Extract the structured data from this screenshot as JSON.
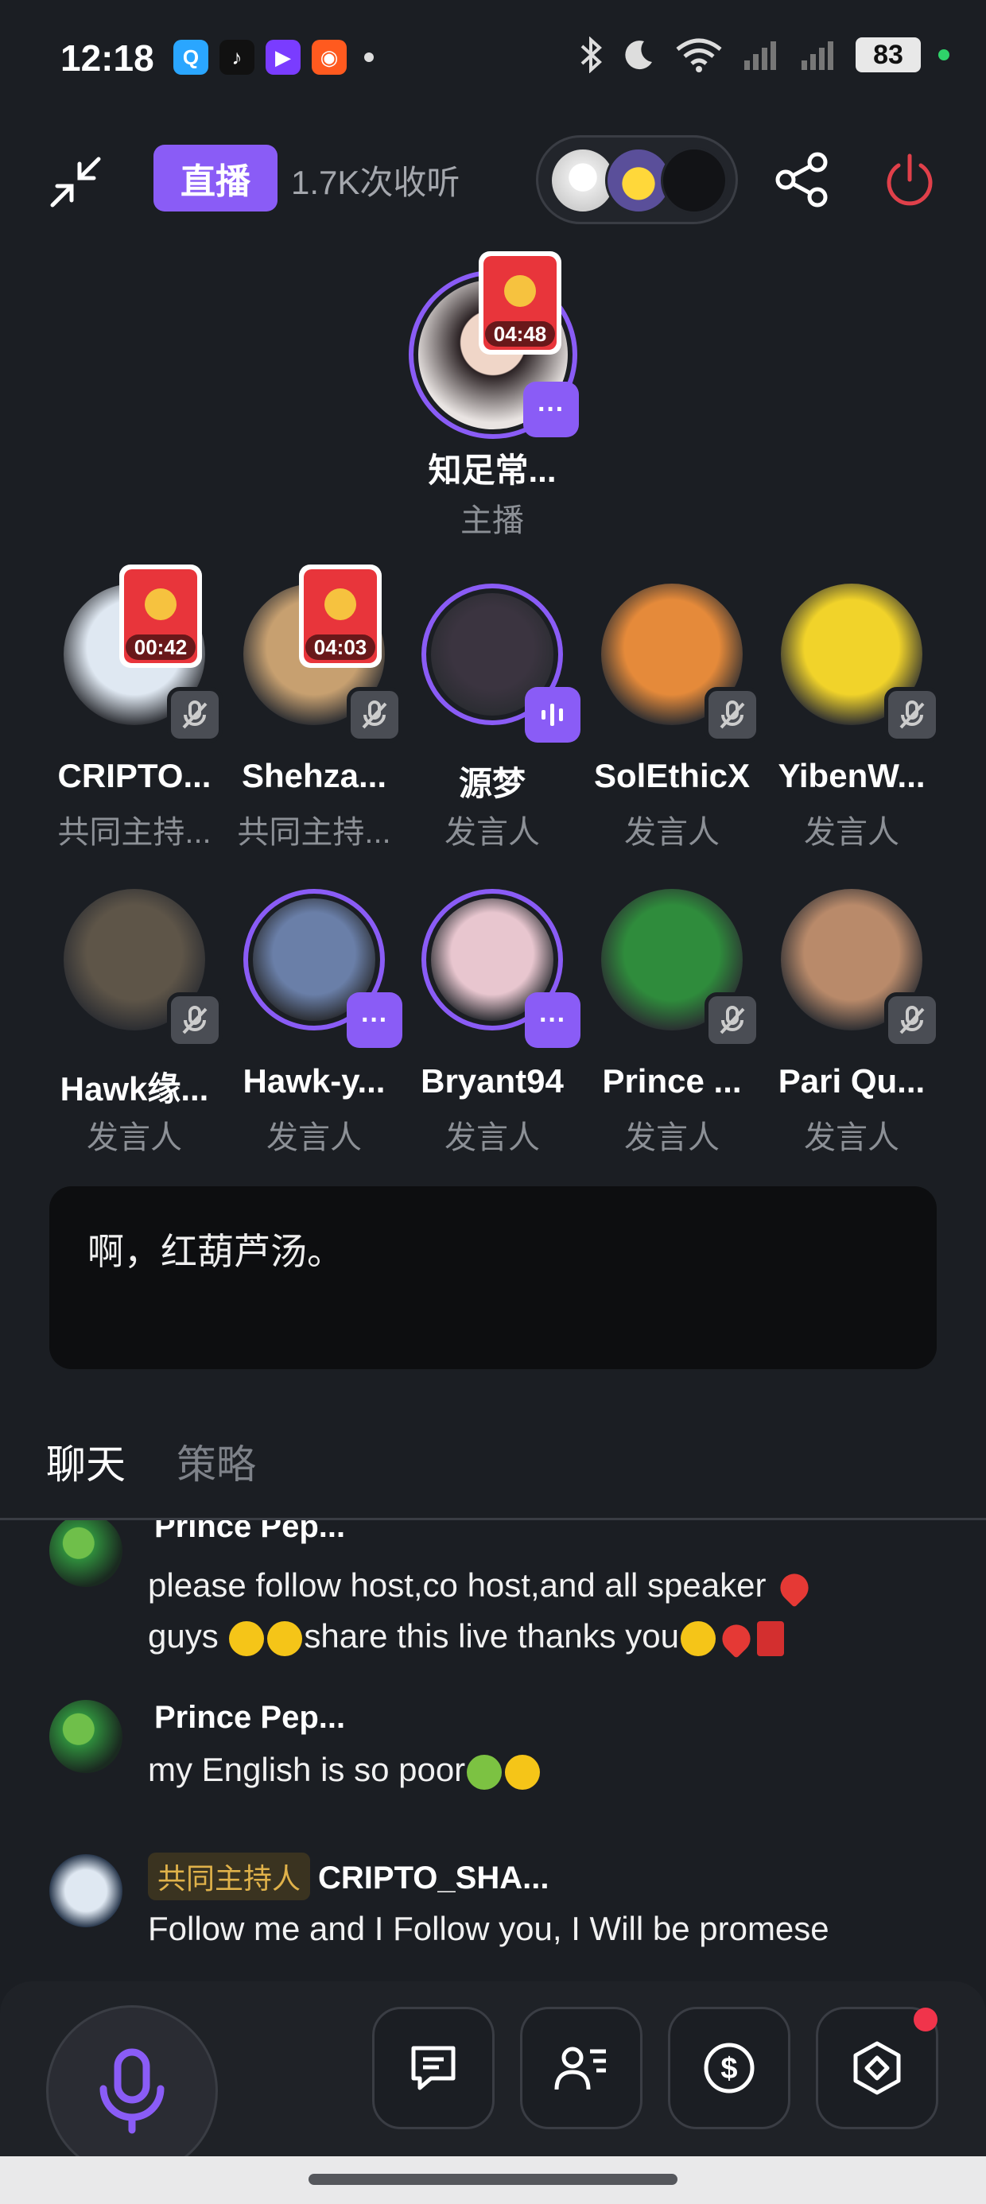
{
  "status_bar": {
    "time": "12:18",
    "battery": "83",
    "apps": [
      {
        "icon": "qq-icon",
        "color": "#2aa6ff",
        "glyph": "Q"
      },
      {
        "icon": "tiktok-icon",
        "color": "#111111",
        "glyph": "♪"
      },
      {
        "icon": "video-app-icon",
        "color": "#7a3cff",
        "glyph": "▶"
      },
      {
        "icon": "kuaishou-icon",
        "color": "#ff5a1f",
        "glyph": "◉"
      }
    ]
  },
  "header": {
    "live_label": "直播",
    "listen_count": "1.7K次收听"
  },
  "host": {
    "name": "知足常...",
    "role": "主播",
    "redpacket_time": "04:48",
    "badge": "···"
  },
  "speakers_row1": [
    {
      "name": "CRIPTO...",
      "role": "共同主持...",
      "redpacket_time": "00:42",
      "avatar_color": "#dfe8f2",
      "muted": true
    },
    {
      "name": "Shehza...",
      "role": "共同主持...",
      "redpacket_time": "04:03",
      "avatar_color": "#c7a070",
      "muted": true
    },
    {
      "name": "源梦",
      "role": "发言人",
      "avatar_color": "#3b3440",
      "speaking": true
    },
    {
      "name": "SolEthicX",
      "role": "发言人",
      "avatar_color": "#e58a3a",
      "muted": true
    },
    {
      "name": "YibenW...",
      "role": "发言人",
      "avatar_color": "#f1d32a",
      "muted": true
    }
  ],
  "speakers_row2": [
    {
      "name": "Hawk缘...",
      "role": "发言人",
      "avatar_color": "#5e5548",
      "muted": true
    },
    {
      "name": "Hawk-y...",
      "role": "发言人",
      "avatar_color": "#6a7fa8",
      "ring": true,
      "badge": "···"
    },
    {
      "name": "Bryant94",
      "role": "发言人",
      "avatar_color": "#e8c6cf",
      "ring": true,
      "badge": "···"
    },
    {
      "name": "Prince ...",
      "role": "发言人",
      "avatar_color": "#2f8c3c",
      "muted": true
    },
    {
      "name": "Pari Qu...",
      "role": "发言人",
      "avatar_color": "#b98a6a",
      "muted": true
    }
  ],
  "announcement": "啊，红葫芦汤。",
  "tabs": {
    "chat": "聊天",
    "strategy": "策略"
  },
  "chat": [
    {
      "name": "Prince Pep...",
      "text": "please follow host,co host,and all speaker",
      "text2": "guys",
      "text3": "share this live thanks you",
      "avatar_color": "#2f8c3c"
    },
    {
      "name": "Prince Pep...",
      "text": "my English is so poor",
      "avatar_color": "#2f8c3c"
    },
    {
      "tag": "共同主持人",
      "name": "CRIPTO_SHA...",
      "text": "Follow me and I Follow you, I Will be promese",
      "avatar_color": "#dfe8f2"
    }
  ],
  "colors": {
    "accent": "#8a5cf6",
    "background": "#1b1e23",
    "danger": "#e0404a",
    "notif": "#f0344b"
  }
}
